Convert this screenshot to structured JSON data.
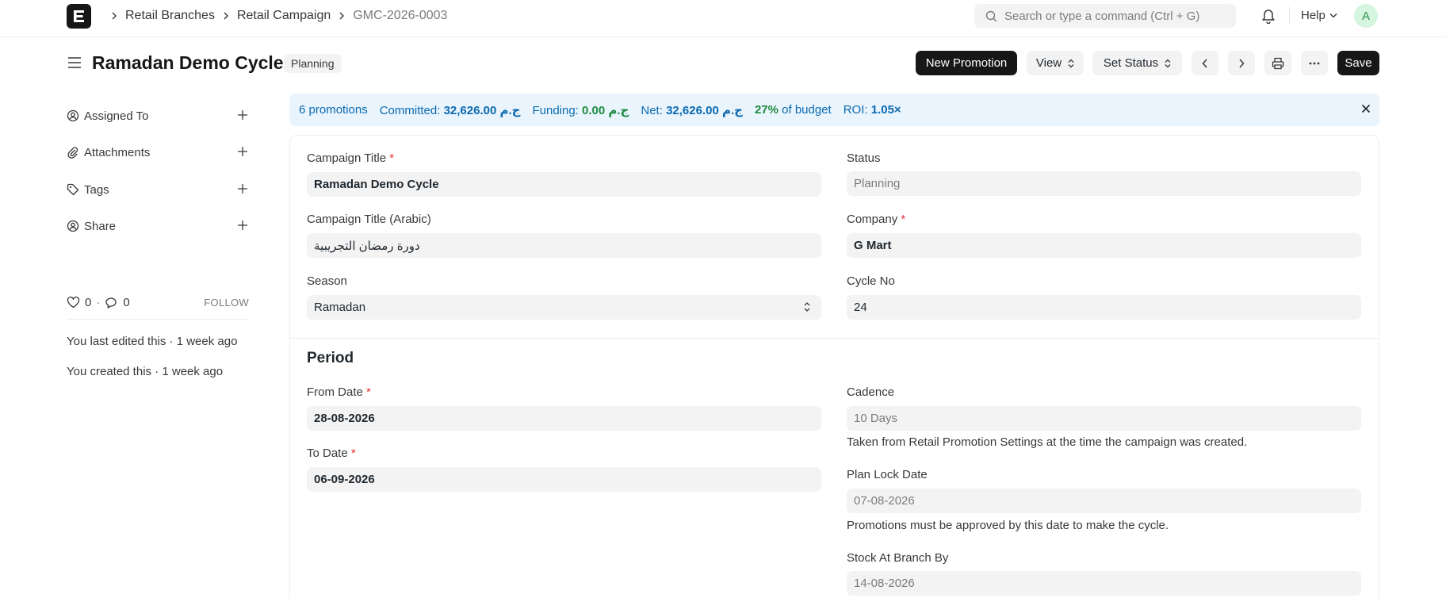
{
  "navbar": {
    "breadcrumbs": [
      "Retail Branches",
      "Retail Campaign",
      "GMC-2026-0003"
    ],
    "search_placeholder": "Search or type a command (Ctrl + G)",
    "help_label": "Help",
    "avatar_initial": "A"
  },
  "header": {
    "title": "Ramadan Demo Cycle",
    "status": "Planning",
    "buttons": {
      "new_promotion": "New Promotion",
      "view": "View",
      "set_status": "Set Status",
      "save": "Save"
    }
  },
  "sidebar": {
    "items": [
      {
        "label": "Assigned To",
        "icon": "user-circle-icon"
      },
      {
        "label": "Attachments",
        "icon": "paperclip-icon"
      },
      {
        "label": "Tags",
        "icon": "tag-icon"
      },
      {
        "label": "Share",
        "icon": "share-user-icon"
      }
    ],
    "likes": "0",
    "comments": "0",
    "follow_label": "FOLLOW",
    "activity": [
      "You last edited this · 1 week ago",
      "You created this · 1 week ago"
    ]
  },
  "summary": {
    "promotions_count": "6",
    "promotions_label": "promotions",
    "committed_label": "Committed:",
    "committed_value": "32,626.00 ج.م",
    "funding_label": "Funding:",
    "funding_value": "0.00 ج.م",
    "net_label": "Net:",
    "net_value": "32,626.00 ج.م",
    "budget_pct": "27%",
    "budget_label": "of budget",
    "roi_label": "ROI:",
    "roi_value": "1.05×"
  },
  "form": {
    "campaign_title": {
      "label": "Campaign Title",
      "value": "Ramadan Demo Cycle"
    },
    "status": {
      "label": "Status",
      "value": "Planning"
    },
    "campaign_title_ar": {
      "label": "Campaign Title (Arabic)",
      "value": "دورة رمضان التجريبية"
    },
    "company": {
      "label": "Company",
      "value": "G Mart"
    },
    "season": {
      "label": "Season",
      "value": "Ramadan"
    },
    "cycle_no": {
      "label": "Cycle No",
      "value": "24"
    },
    "period_title": "Period",
    "from_date": {
      "label": "From Date",
      "value": "28-08-2026"
    },
    "to_date": {
      "label": "To Date",
      "value": "06-09-2026"
    },
    "cadence": {
      "label": "Cadence",
      "value": "10 Days",
      "description": "Taken from Retail Promotion Settings at the time the campaign was created."
    },
    "plan_lock_date": {
      "label": "Plan Lock Date",
      "value": "07-08-2026",
      "description": "Promotions must be approved by this date to make the cycle."
    },
    "stock_at_branch_by": {
      "label": "Stock At Branch By",
      "value": "14-08-2026"
    }
  },
  "colors": {
    "accent_dark": "#171717",
    "banner_bg": "#e9f4fd",
    "banner_text": "#0b6ab0",
    "positive": "#1e8a3e",
    "required": "#e03636"
  }
}
